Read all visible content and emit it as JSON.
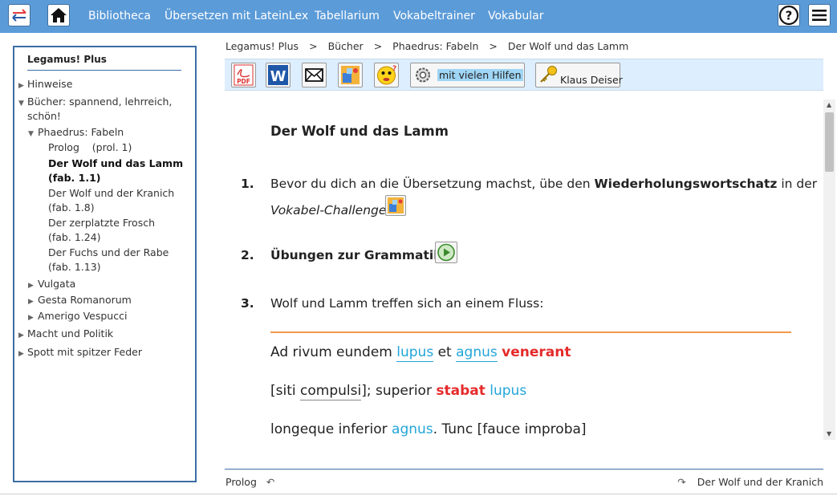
{
  "nav": {
    "links": [
      "Bibliotheca",
      "Übersetzen mit LateinLex",
      "Tabellarium",
      "Vokabeltrainer",
      "Vokabular"
    ],
    "left_icons": [
      "swap-arrows-icon",
      "home-icon"
    ],
    "right_icons": [
      "help-icon",
      "menu-icon"
    ]
  },
  "sidebar": {
    "title": "Legamus! Plus",
    "items": [
      {
        "label": "Hinweise",
        "expanded": false
      },
      {
        "label": "Bücher: spannend, lehrreich, schön!",
        "expanded": true
      },
      {
        "label": "Phaedrus: Fabeln",
        "expanded": true
      },
      {
        "label": "Prolog    (prol. 1)"
      },
      {
        "label": "Der Wolf und das Lamm (fab. 1.1)",
        "active": true
      },
      {
        "label": "Der Wolf und der Kranich (fab. 1.8)"
      },
      {
        "label": "Der zerplatzte Frosch    (fab. 1.24)"
      },
      {
        "label": "Der Fuchs und der Rabe (fab. 1.13)"
      },
      {
        "label": "Vulgata",
        "expanded": false
      },
      {
        "label": "Gesta Romanorum",
        "expanded": false
      },
      {
        "label": "Amerigo Vespucci",
        "expanded": false
      },
      {
        "label": "Macht und Politik",
        "expanded": false
      },
      {
        "label": "Spott mit spitzer Feder",
        "expanded": false
      }
    ]
  },
  "breadcrumb": [
    "Legamus! Plus",
    "Bücher",
    "Phaedrus: Fabeln",
    "Der Wolf und das Lamm"
  ],
  "breadcrumb_sep": ">",
  "toolbar": {
    "pdf_label": "PDF",
    "word_label": "W",
    "helps_label": "mit vielen Hilfen",
    "author_label": "Klaus Deiser",
    "icons": [
      "pdf-icon",
      "word-icon",
      "mail-icon",
      "vocab-challenge-icon",
      "quiz-face-icon",
      "gear-icon",
      "key-icon"
    ]
  },
  "content": {
    "title": "Der Wolf und das Lamm",
    "steps": [
      {
        "num": "1.",
        "pre": "Bevor du dich an die Übersetzung machst, übe den ",
        "bold": "Wiederholungswortschatz",
        "post": " in der",
        "line2": "Vokabel-Challenge"
      },
      {
        "num": "2.",
        "text": "Übungen zur Grammatik"
      },
      {
        "num": "3.",
        "text": "Wolf und Lamm treffen sich an einem Fluss:"
      }
    ],
    "latin": {
      "line1": [
        "Ad rivum eundem ",
        "lupus",
        " et ",
        "agnus",
        " ",
        "venerant"
      ],
      "line2": [
        "[",
        "siti ",
        "compulsi",
        "]; superior ",
        "stabat",
        " ",
        "lupus"
      ],
      "line3": [
        "longeque inferior ",
        "agnus",
        ". Tunc ",
        "[",
        "fauce improba",
        "]"
      ]
    }
  },
  "footer": {
    "prev": "Prolog",
    "next": "Der Wolf und der Kranich"
  },
  "colors": {
    "topbar": "#5b9bd8",
    "accent_blue": "#22a5d9",
    "accent_red": "#e52b2b",
    "orange_rule": "#f19a4a",
    "toolbar_bg": "#ddeeff"
  }
}
